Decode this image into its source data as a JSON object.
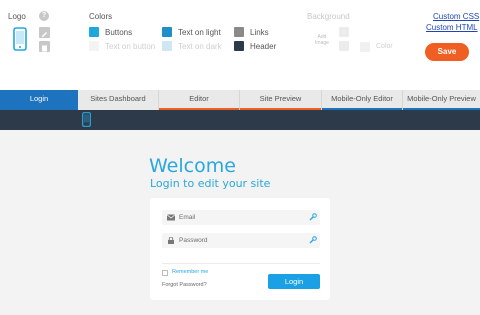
{
  "settings": {
    "logo_label": "Logo",
    "help_symbol": "?",
    "colors_label": "Colors",
    "swatches": [
      {
        "label": "Buttons",
        "color": "#1ea8e0"
      },
      {
        "label": "Text on light",
        "color": "#1e8fc7"
      },
      {
        "label": "Links",
        "color": "#8a8a8a"
      },
      {
        "label": "Text on button",
        "color": "#f4f4f4"
      },
      {
        "label": "Text on dark",
        "color": "#cfe6f3"
      },
      {
        "label": "Header",
        "color": "#2d3a4a"
      }
    ],
    "background_label": "Background",
    "add_image_label": "Add Image",
    "bg_color_label": "Color",
    "custom_css": "Custom CSS",
    "custom_html": "Custom HTML",
    "save_label": "Save",
    "accent_save": "#ef5e23"
  },
  "tabs": [
    {
      "label": "Login",
      "active": true,
      "bar": ""
    },
    {
      "label": "Sites Dashboard",
      "active": false,
      "bar": ""
    },
    {
      "label": "Editor",
      "active": false,
      "bar": "#ef5e23"
    },
    {
      "label": "Site Preview",
      "active": false,
      "bar": "#ef5e23"
    },
    {
      "label": "Mobile-Only Editor",
      "active": false,
      "bar": "#1e73be"
    },
    {
      "label": "Mobile-Only Preview",
      "active": false,
      "bar": "#1e73be"
    }
  ],
  "login": {
    "title": "Welcome",
    "subtitle": "Login to edit your site",
    "email_placeholder": "Email",
    "password_placeholder": "Password",
    "remember_label": "Remember me",
    "forgot_label": "Forgot Password?",
    "button_label": "Login"
  },
  "icons": {
    "phone": "phone-icon",
    "edit": "pencil-icon",
    "document": "document-icon",
    "email": "envelope-icon",
    "password": "lock-icon",
    "wrench": "wrench-icon"
  }
}
